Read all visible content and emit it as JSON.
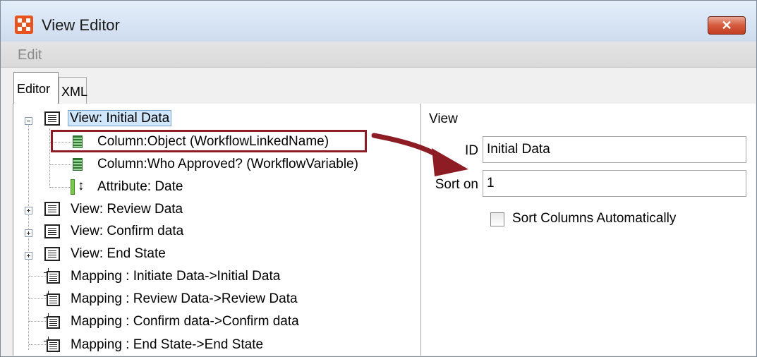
{
  "window": {
    "title": "View Editor",
    "close_label": "✕"
  },
  "menu": {
    "edit_label": "Edit"
  },
  "tabs": {
    "editor_label": "Editor",
    "xml_label": "XML"
  },
  "tree": {
    "view_initial": "View: Initial Data",
    "col_object": "Column:Object (WorkflowLinkedName)",
    "col_who": "Column:Who Approved? (WorkflowVariable)",
    "attr_date": "Attribute: Date",
    "view_review": "View: Review Data",
    "view_confirm": "View: Confirm data",
    "view_end": "View: End State",
    "map_initiate": "Mapping : Initiate Data->Initial Data",
    "map_review": "Mapping : Review Data->Review Data",
    "map_confirm": "Mapping : Confirm data->Confirm data",
    "map_end": "Mapping : End State->End State"
  },
  "props": {
    "section_label": "View",
    "id_label": "ID",
    "id_value": "Initial Data",
    "sort_label": "Sort on",
    "sort_value": "1",
    "sort_auto_label": "Sort Columns Automatically",
    "sort_auto_checked": false
  },
  "colors": {
    "annotation": "#8e1c24",
    "selection": "#cfe6fb",
    "close_button": "#c9472a"
  },
  "icons": {
    "view": "view-icon",
    "column": "column-icon",
    "attribute": "attribute-icon",
    "mapping": "mapping-icon"
  }
}
